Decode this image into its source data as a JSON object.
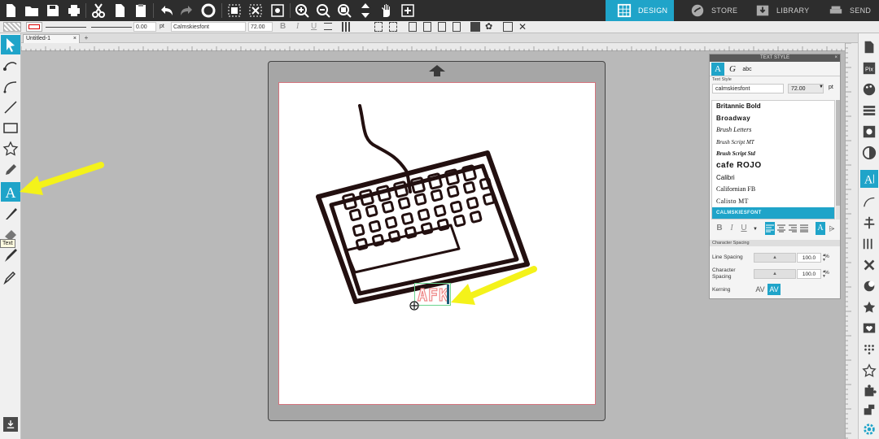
{
  "toolbar": {
    "icons": [
      "new-icon",
      "open-icon",
      "save-icon",
      "print-icon",
      "cut-icon",
      "copy-icon",
      "paste-icon",
      "undo-icon",
      "redo-icon",
      "redraw-icon",
      "select-all-icon",
      "deselect-icon",
      "edit-points-icon",
      "zoom-in-icon",
      "zoom-out-icon",
      "zoom-fit-icon",
      "move-icon",
      "pan-icon",
      "add-icon"
    ],
    "nav": [
      {
        "label": "DESIGN",
        "icon": "grid-icon",
        "active": true
      },
      {
        "label": "STORE",
        "icon": "store-icon",
        "active": false
      },
      {
        "label": "LIBRARY",
        "icon": "library-icon",
        "active": false
      },
      {
        "label": "SEND",
        "icon": "send-icon",
        "active": false
      }
    ]
  },
  "properties": {
    "line_width": "0.00",
    "line_unit": "pt",
    "font_name": "Calmskiesfont",
    "font_size": "72.00",
    "bold": "B",
    "italic": "I",
    "underline": "U"
  },
  "tabs": {
    "document": "Untitled-1",
    "close": "×",
    "add": "+"
  },
  "tooltip": "Text",
  "canvas_text": "AFK",
  "panel": {
    "title": "TEXT STYLE",
    "close": "×",
    "section_text_style": "Text Style",
    "font_search": "calmskiesfont",
    "font_size": "72.00",
    "font_unit": "pt",
    "fonts": [
      "Britannic Bold",
      "Broadway",
      "Brush Letters",
      "Brush Script MT",
      "Brush Script Std",
      "cafe ROJO",
      "Calibri",
      "Californian FB",
      "Calisto MT",
      "CALMSKIESFONT"
    ],
    "selected_font_index": 9,
    "format": {
      "bold": "B",
      "italic": "I",
      "underline": "U"
    },
    "section_spacing": "Character Spacing",
    "line_spacing_label": "Line Spacing",
    "line_spacing_value": "100.0",
    "char_spacing_label": "Character Spacing",
    "char_spacing_value": "100.0",
    "percent": "%",
    "kerning_label": "Kerning",
    "kern_off": "AV",
    "kern_on": "AV"
  },
  "colors": {
    "accent": "#1fa4c9",
    "toolbar_bg": "#2d2d2d",
    "arrow_yellow": "#f4f21a",
    "text_pink": "#ef8a8a"
  }
}
